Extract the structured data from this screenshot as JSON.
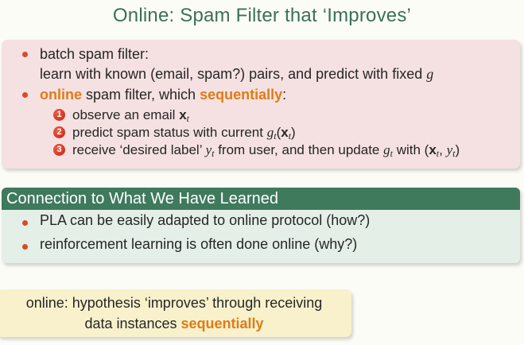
{
  "title": "Online: Spam Filter that ‘Improves’",
  "pink_block": {
    "bullet1_line1": "batch spam filter:",
    "bullet1_line2_pre": "learn with known (email, spam?) pairs, and predict with fixed ",
    "bullet1_g": "g",
    "bullet2_online": "online",
    "bullet2_mid": " spam filter, which ",
    "bullet2_seq": "sequentially",
    "bullet2_colon": ":",
    "steps": [
      {
        "num": "1",
        "pre": "observe an email ",
        "x": "x",
        "t": "t"
      },
      {
        "num": "2",
        "pre": "predict spam status with current ",
        "g": "g",
        "t": "t",
        "x": "x",
        "open": "(",
        "close": ")"
      },
      {
        "num": "3",
        "pre": "receive ‘desired label’ ",
        "y": "y",
        "mid": " from user, and then update ",
        "g": "g",
        "post": " with (",
        "x": "x",
        "comma": ", ",
        "close": ")"
      }
    ]
  },
  "green_block": {
    "header": "Connection to What We Have Learned",
    "items": [
      "PLA can be easily adapted to online protocol (how?)",
      "reinforcement learning is often done online (why?)"
    ]
  },
  "yellow_block": {
    "line1": "online: hypothesis ‘improves’ through receiving",
    "line2_pre": "data instances ",
    "line2_seq": "sequentially"
  },
  "colors": {
    "title": "#3b6f58",
    "accent_orange": "#e07b16",
    "bullet_red": "#d94a2a",
    "green_header": "#3f7a5c"
  }
}
